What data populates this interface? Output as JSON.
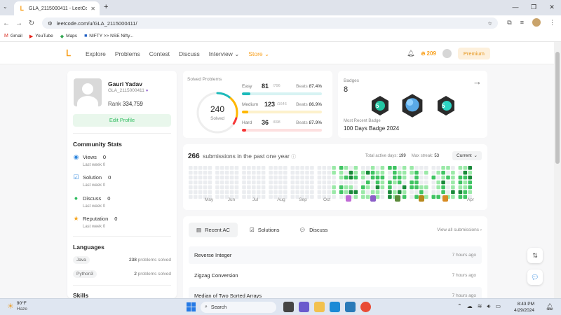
{
  "browser": {
    "tab_title": "GLA_2115000411 - LeetCode P",
    "url": "leetcode.com/u/GLA_2115000411/",
    "bookmarks": [
      "Gmail",
      "YouTube",
      "Maps",
      "NIFTY >> NSE Nifty..."
    ]
  },
  "nav": {
    "links": [
      "Explore",
      "Problems",
      "Contest",
      "Discuss",
      "Interview",
      "Store"
    ],
    "streak": "209",
    "premium": "Premium"
  },
  "profile": {
    "name": "Gauri Yadav",
    "username": "GLA_2115000411",
    "rank_label": "Rank",
    "rank_value": "334,759",
    "edit_button": "Edit Profile"
  },
  "community": {
    "title": "Community Stats",
    "last_week": "Last week",
    "items": [
      {
        "label": "Views",
        "value": "0",
        "delta": "0"
      },
      {
        "label": "Solution",
        "value": "0",
        "delta": "0"
      },
      {
        "label": "Discuss",
        "value": "0",
        "delta": "0"
      },
      {
        "label": "Reputation",
        "value": "0",
        "delta": "0"
      }
    ]
  },
  "languages": {
    "title": "Languages",
    "items": [
      {
        "name": "Java",
        "count": "238",
        "suffix": "problems solved"
      },
      {
        "name": "Python3",
        "count": "2",
        "suffix": "problems solved"
      }
    ]
  },
  "skills_title": "Skills",
  "solved": {
    "title": "Solved Problems",
    "total": "240",
    "total_label": "Solved",
    "beats_label": "Beats",
    "difficulties": [
      {
        "name": "Easy",
        "count": "81",
        "total": "/796",
        "beats": "87.4%",
        "color": "#1cbaba",
        "fraction": 0.102
      },
      {
        "name": "Medium",
        "count": "123",
        "total": "/1646",
        "beats": "86.9%",
        "color": "#ffb700",
        "fraction": 0.075
      },
      {
        "name": "Hard",
        "count": "36",
        "total": "/698",
        "beats": "87.9%",
        "color": "#f63737",
        "fraction": 0.052
      }
    ]
  },
  "badges": {
    "title": "Badges",
    "count": "8",
    "recent_label": "Most Recent Badge",
    "recent_name": "100 Days Badge 2024"
  },
  "submissions": {
    "count": "266",
    "text": "submissions in the past one year",
    "active_days_label": "Total active days:",
    "active_days": "199",
    "max_streak_label": "Max streak:",
    "max_streak": "53",
    "period": "Current",
    "months": [
      "May",
      "Jun",
      "Jul",
      "Aug",
      "Sep",
      "Oct",
      "Nov",
      "Dec",
      "Jan",
      "Feb",
      "Mar",
      "Apr"
    ]
  },
  "recent": {
    "tabs": [
      "Recent AC",
      "Solutions",
      "Discuss"
    ],
    "view_all": "View all submissions",
    "rows": [
      {
        "title": "Reverse Integer",
        "ago": "7 hours ago"
      },
      {
        "title": "Zigzag Conversion",
        "ago": "7 hours ago"
      },
      {
        "title": "Median of Two Sorted Arrays",
        "ago": "7 hours ago"
      }
    ]
  },
  "taskbar": {
    "temp": "90°F",
    "weather": "Haze",
    "search": "Search",
    "time": "8:43 PM",
    "date": "4/29/2024"
  }
}
